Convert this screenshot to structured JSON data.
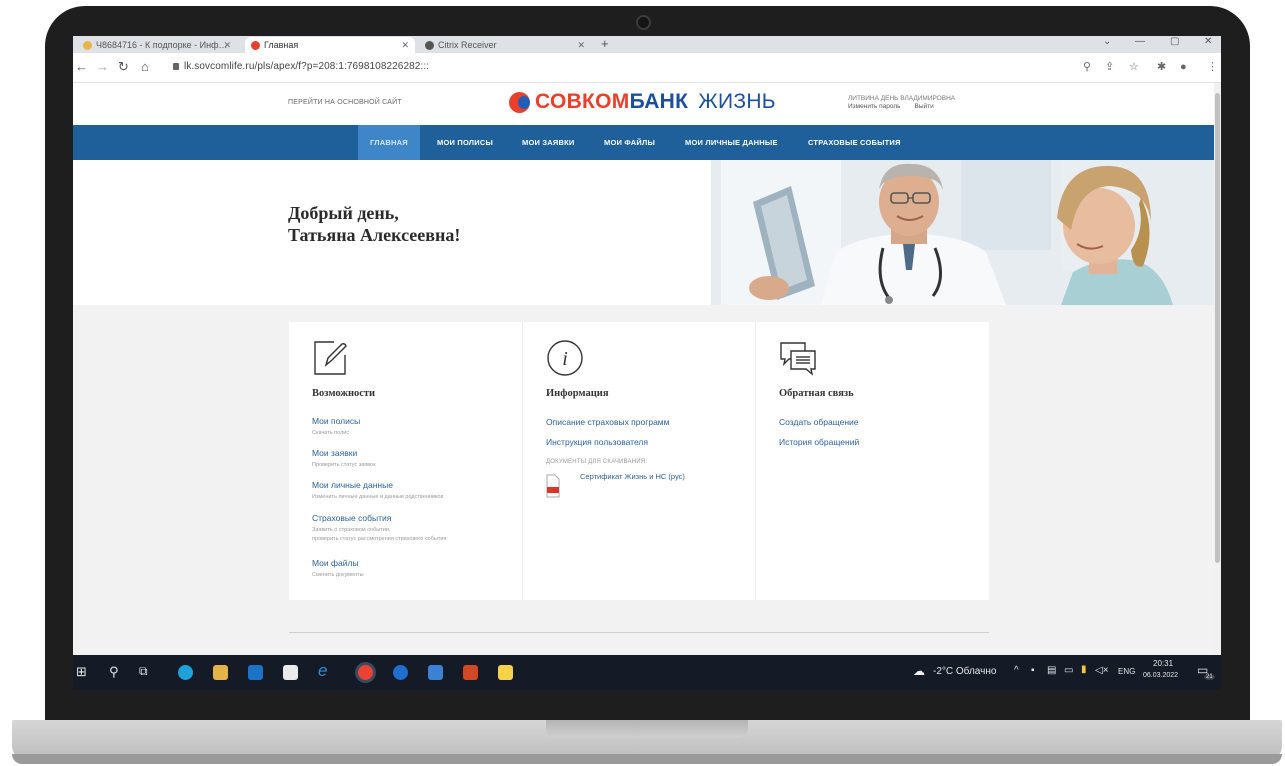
{
  "browser": {
    "tabs": [
      {
        "label": "Ч8684716 - К подпорке - Инф…",
        "active": false
      },
      {
        "label": "Главная",
        "active": true
      },
      {
        "label": "Citrix Receiver",
        "active": false
      }
    ],
    "url": "lk.sovcomlife.ru/pls/apex/f?p=208:1:7698108226282:::"
  },
  "site": {
    "top_link": "ПЕРЕЙТИ НА ОСНОВНОЙ САЙТ",
    "logo": {
      "part1": "СОВКОМ",
      "part2": "БАНК",
      "part3": "ЖИЗНЬ"
    },
    "user": {
      "name": "ЛИТВИНА ДЕНЬ ВЛАДИМИРОВНА",
      "change_password": "Изменить пароль",
      "logout": "Выйти"
    },
    "nav": [
      "ГЛАВНАЯ",
      "МОИ ПОЛИСЫ",
      "МОИ ЗАЯВКИ",
      "МОИ ФАЙЛЫ",
      "МОИ ЛИЧНЫЕ ДАННЫЕ",
      "СТРАХОВЫЕ СОБЫТИЯ"
    ],
    "greeting_line1": "Добрый день,",
    "greeting_line2": "Татьяна Алексеевна!"
  },
  "columns": {
    "features": {
      "title": "Возможности",
      "items": [
        {
          "link": "Мои полисы",
          "sub": "Скачать полис"
        },
        {
          "link": "Мои заявки",
          "sub": "Проверить статус заявок"
        },
        {
          "link": "Мои личные данные",
          "sub": "Изменить личные данные и данные родственников"
        },
        {
          "link": "Страховые события",
          "sub": "Заявить о страховом событии,",
          "sub2": "проверить статус рассмотрения страхового события"
        },
        {
          "link": "Мои файлы",
          "sub": "Сменить документы"
        }
      ]
    },
    "info": {
      "title": "Информация",
      "items": [
        "Описание страховых программ",
        "Инструкция пользователя"
      ],
      "docs_label": "ДОКУМЕНТЫ ДЛЯ СКАЧИВАНИЯ:",
      "doc": "Сертификат Жизнь и НС (рус)"
    },
    "feedback": {
      "title": "Обратная связь",
      "items": [
        "Создать обращение",
        "История обращений"
      ]
    }
  },
  "taskbar": {
    "weather": "-2°C Облачно",
    "lang": "ENG",
    "time": "20:31",
    "date": "06.03.2022",
    "notifications": "21"
  },
  "colors": {
    "nav_bg": "#1f5f9a",
    "nav_active": "#3f86c9",
    "logo_red": "#e8402b",
    "logo_blue": "#1c4f9c",
    "link": "#2b5f98"
  }
}
